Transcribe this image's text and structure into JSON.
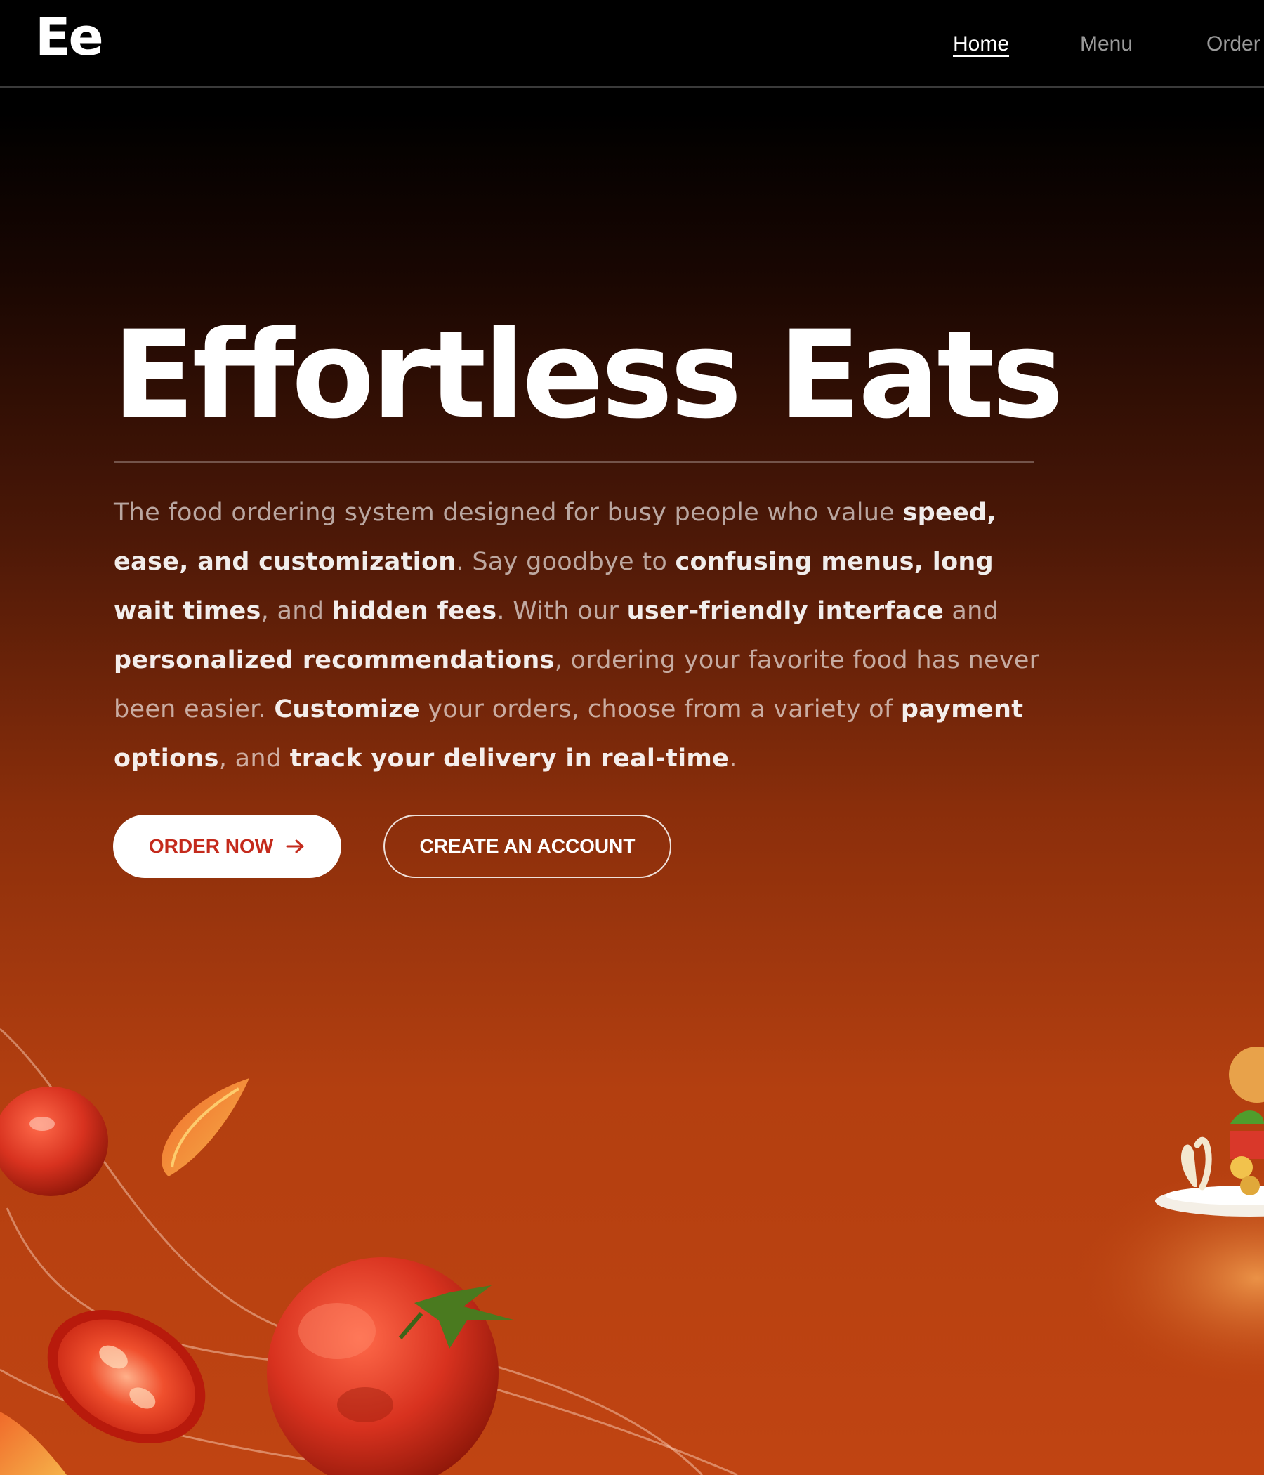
{
  "header": {
    "logo": "Ee",
    "nav": [
      {
        "label": "Home",
        "active": true
      },
      {
        "label": "Menu",
        "active": false
      },
      {
        "label": "Order",
        "active": false
      }
    ]
  },
  "hero": {
    "title": "Effortless Eats",
    "description": [
      {
        "text": "The food ordering system designed for busy people who value ",
        "strong": false
      },
      {
        "text": "speed, ease, and customization",
        "strong": true
      },
      {
        "text": ". Say goodbye to ",
        "strong": false
      },
      {
        "text": "confusing menus, long wait times",
        "strong": true
      },
      {
        "text": ", and ",
        "strong": false
      },
      {
        "text": "hidden fees",
        "strong": true
      },
      {
        "text": ". With our ",
        "strong": false
      },
      {
        "text": "user-friendly interface",
        "strong": true
      },
      {
        "text": " and ",
        "strong": false
      },
      {
        "text": "personalized recommendations",
        "strong": true
      },
      {
        "text": ", ordering your favorite food has never been easier. ",
        "strong": false
      },
      {
        "text": "Customize",
        "strong": true
      },
      {
        "text": " your orders, choose from a variety of ",
        "strong": false
      },
      {
        "text": "payment options",
        "strong": true
      },
      {
        "text": ", and ",
        "strong": false
      },
      {
        "text": "track your delivery in real-time",
        "strong": true
      },
      {
        "text": ".",
        "strong": false
      }
    ],
    "primary_button": {
      "label": "ORDER NOW",
      "icon": "arrow-right-icon"
    },
    "secondary_button": {
      "label": "CREATE AN ACCOUNT"
    }
  },
  "colors": {
    "background_top": "#000000",
    "background_bottom": "#c04412",
    "primary_button_text": "#c42a1c",
    "tomato": "#d8321f"
  }
}
